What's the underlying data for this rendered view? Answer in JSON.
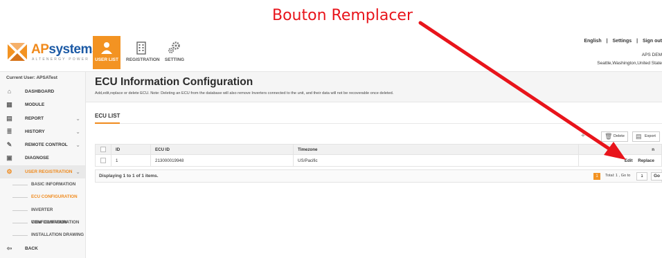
{
  "annotation": {
    "title": "Bouton Remplacer",
    "arrow_color": "#e8141b"
  },
  "brand": {
    "logo_main_a": "AP",
    "logo_main_b": "systems",
    "logo_sub": "ALTENERGY POWER",
    "accent": "#f39322",
    "blue": "#1c5aa5"
  },
  "nav": {
    "tabs": [
      {
        "label": "USER LIST",
        "icon": "user-icon",
        "active": true
      },
      {
        "label": "REGISTRATION",
        "icon": "building-icon",
        "active": false
      },
      {
        "label": "SETTING",
        "icon": "gears-icon",
        "active": false
      }
    ]
  },
  "toplinks": {
    "language": "English",
    "sep": "|",
    "settings": "Settings",
    "signout": "Sign out"
  },
  "account": {
    "name": "APS DEM",
    "location": "Seattle,Washington,United State"
  },
  "sidebar": {
    "current_user": "Current User: APSATest",
    "items": [
      {
        "label": "DASHBOARD",
        "icon": "home-icon",
        "chevron": false
      },
      {
        "label": "MODULE",
        "icon": "grid-icon",
        "chevron": false
      },
      {
        "label": "REPORT",
        "icon": "report-icon",
        "chevron": true
      },
      {
        "label": "HISTORY",
        "icon": "database-icon",
        "chevron": true
      },
      {
        "label": "REMOTE CONTROL",
        "icon": "wrench-icon",
        "chevron": true
      },
      {
        "label": "DIAGNOSE",
        "icon": "diagnose-icon",
        "chevron": false
      },
      {
        "label": "USER REGISTRATION",
        "icon": "cogs-icon",
        "chevron": true
      }
    ],
    "subitems": [
      {
        "label": "BASIC INFORMATION",
        "active": false
      },
      {
        "label": "ECU CONFIGURATION",
        "active": true
      },
      {
        "label": "INVERTER CONFIGURATION",
        "active": false
      },
      {
        "label": "VIEW CONFIGURATION",
        "active": false
      },
      {
        "label": "INSTALLATION DRAWING",
        "active": false
      }
    ],
    "back": "BACK"
  },
  "main": {
    "title": "ECU Information Configuration",
    "description": "Add,edit,replace or delete ECU. Note: Deleting an ECU from the database will also remove Inverters connected to the unit, and their data will not be recoverable once deleted.",
    "section": "ECU LIST",
    "toolbar": {
      "add": "+",
      "delete": "Delete",
      "export": "Export"
    },
    "table": {
      "headers": {
        "id": "ID",
        "ecu_id": "ECU ID",
        "timezone": "Timezone",
        "action": "n"
      },
      "rows": [
        {
          "id": "1",
          "ecu_id": "213000019948",
          "timezone": "US/Pacific",
          "edit": "Edit",
          "replace": "Replace"
        }
      ]
    },
    "pager": {
      "info": "Displaying 1 to 1 of 1 items.",
      "page": "1",
      "total": "Total: 1 , Go to",
      "goto_value": "1",
      "go": "Go"
    }
  }
}
